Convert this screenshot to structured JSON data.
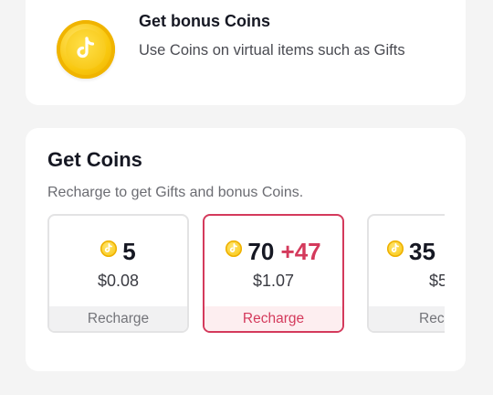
{
  "bonus_card": {
    "icon": "coin-icon",
    "title": "Get bonus Coins",
    "description": "Use Coins on virtual items such as Gifts"
  },
  "get_coins": {
    "title": "Get Coins",
    "subtitle": "Recharge to get Gifts and bonus Coins.",
    "packages": [
      {
        "coins": "5",
        "bonus": "",
        "price": "$0.08",
        "action": "Recharge",
        "selected": false
      },
      {
        "coins": "70",
        "bonus": "+47",
        "price": "$1.07",
        "action": "Recharge",
        "selected": true
      },
      {
        "coins": "35",
        "bonus": "",
        "price": "$5",
        "action": "Rec",
        "selected": false
      }
    ]
  },
  "colors": {
    "accent": "#d43a5c",
    "coin": "#f9c80e",
    "background": "#f4f4f4",
    "card": "#ffffff"
  }
}
